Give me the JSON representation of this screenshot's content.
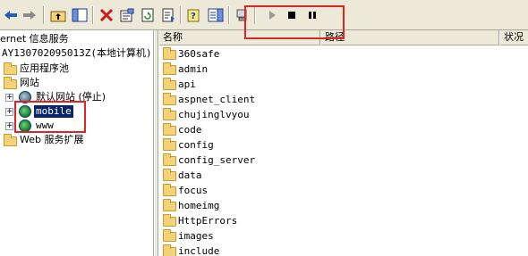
{
  "toolbar": {
    "buttons": [
      {
        "icon": "back-arrow-icon"
      },
      {
        "icon": "forward-arrow-icon"
      },
      {
        "icon": "up-level-icon"
      },
      {
        "icon": "show-hide-tree-icon"
      },
      {
        "icon": "delete-icon"
      },
      {
        "icon": "properties-icon"
      },
      {
        "icon": "refresh-icon"
      },
      {
        "icon": "export-list-icon"
      },
      {
        "icon": "help-icon"
      },
      {
        "icon": "show-hide-action-pane-icon"
      },
      {
        "icon": "connect-computer-icon"
      },
      {
        "icon": "start-icon"
      },
      {
        "icon": "stop-icon"
      },
      {
        "icon": "pause-icon"
      }
    ]
  },
  "tree": {
    "root_label": "ernet 信息服务",
    "server_label": "AY130702095013Z(本地计算机)",
    "app_pools_label": "应用程序池",
    "websites_label": "网站",
    "default_site_label": "默认网站 (停止)",
    "mobile_label": "mobile",
    "www_label": "www",
    "web_ext_label": "Web 服务扩展"
  },
  "list": {
    "columns": {
      "name": "名称",
      "path": "路径",
      "status": "状况"
    },
    "items": [
      "360safe",
      "admin",
      "api",
      "aspnet_client",
      "chujinglvyou",
      "code",
      "config",
      "config_server",
      "data",
      "focus",
      "homeimg",
      "HttpErrors",
      "images",
      "include"
    ]
  },
  "colors": {
    "toolbar_bg": "#ece9d8",
    "selection": "#0a246a",
    "annotation": "#e02424",
    "folder": "#f4d27a"
  }
}
